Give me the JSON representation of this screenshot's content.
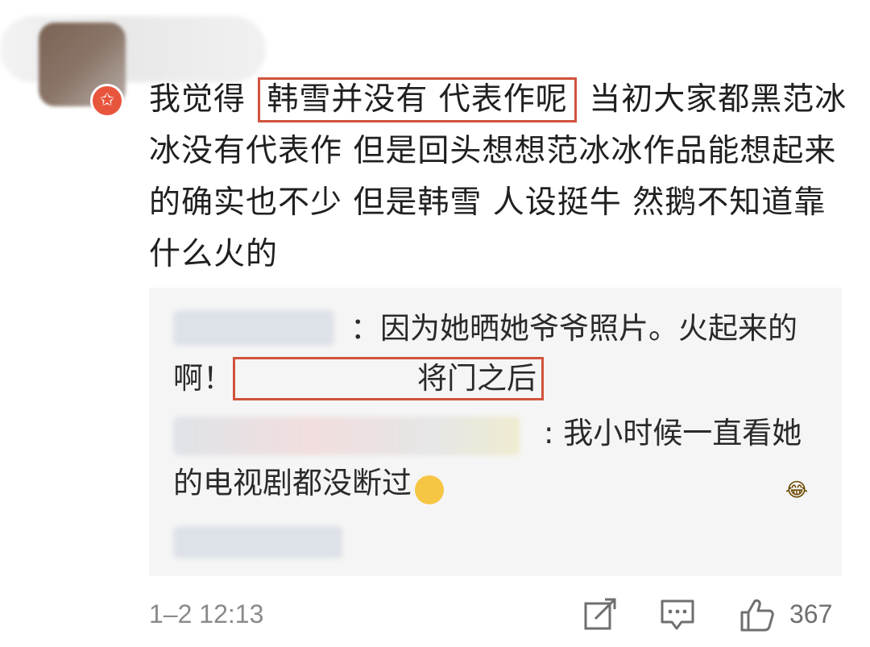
{
  "comment": {
    "text_before": "我觉得 ",
    "highlight": "韩雪并没有 代表作呢",
    "text_after": " 当初大家都黑范冰冰没有代表作 但是回头想想范冰冰作品能想起来的确实也不少 但是韩雪 人设挺牛 然鹅不知道靠什么火的"
  },
  "badge": {
    "icon": "vip-star-icon",
    "glyph": "✩",
    "color": "#e8553d"
  },
  "replies": [
    {
      "text": "：因为她晒她爷爷照片。火起来的啊！",
      "highlight": "将门之后"
    },
    {
      "text": ": 我小时候一直看她的电视剧都没断过",
      "emoji": "😂"
    }
  ],
  "footer": {
    "timestamp": "1–2 12:13",
    "like_count": "367",
    "icons": [
      "share-icon",
      "comment-icon",
      "like-icon"
    ]
  },
  "colors": {
    "highlight_border": "#d0533b",
    "reply_bg": "#f5f5f5"
  }
}
